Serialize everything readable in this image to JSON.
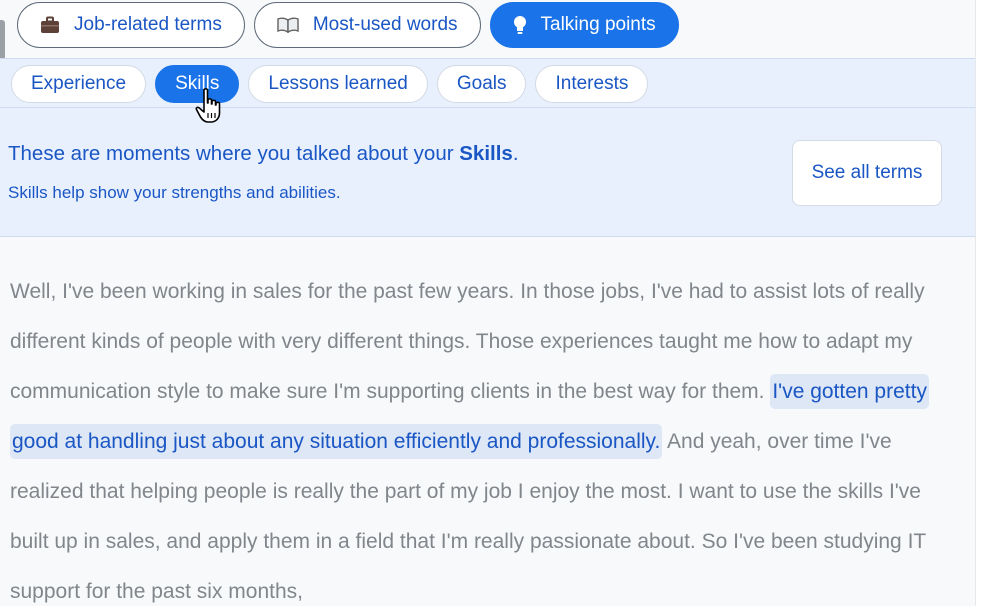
{
  "top_tabs": [
    {
      "label": "Job-related terms",
      "icon": "briefcase-icon",
      "active": false
    },
    {
      "label": "Most-used words",
      "icon": "book-icon",
      "active": false
    },
    {
      "label": "Talking points",
      "icon": "lightbulb-icon",
      "active": true
    }
  ],
  "chips": [
    {
      "label": "Experience",
      "active": false
    },
    {
      "label": "Skills",
      "active": true
    },
    {
      "label": "Lessons learned",
      "active": false
    },
    {
      "label": "Goals",
      "active": false
    },
    {
      "label": "Interests",
      "active": false
    }
  ],
  "header": {
    "headline_prefix": "These are moments where you talked about your ",
    "headline_term": "Skills",
    "headline_suffix": ".",
    "subline": "Skills help show your strengths and abilities.",
    "see_all_label": "See all terms"
  },
  "transcript": {
    "before": "Well, I've been working in sales for the past few years. In those jobs, I've had to assist lots of really different kinds of people with very different things. Those experiences taught me how to adapt my communication style to make sure I'm supporting clients in the best way for them. ",
    "highlight": "I've gotten pretty good at handling just about any situation efficiently and professionally.",
    "after": " And yeah, over time I've realized that helping people is really the part of my job I enjoy the most. I want to use the skills I've built up in sales, and apply them in a field that I'm really passionate about. So I've been studying IT support for the past six months,"
  },
  "colors": {
    "accent": "#1a73e8",
    "text_link": "#1a56c4",
    "highlight_bg": "#dde7f6",
    "panel_bg": "#e8f0fe",
    "body_text": "#80868b"
  }
}
